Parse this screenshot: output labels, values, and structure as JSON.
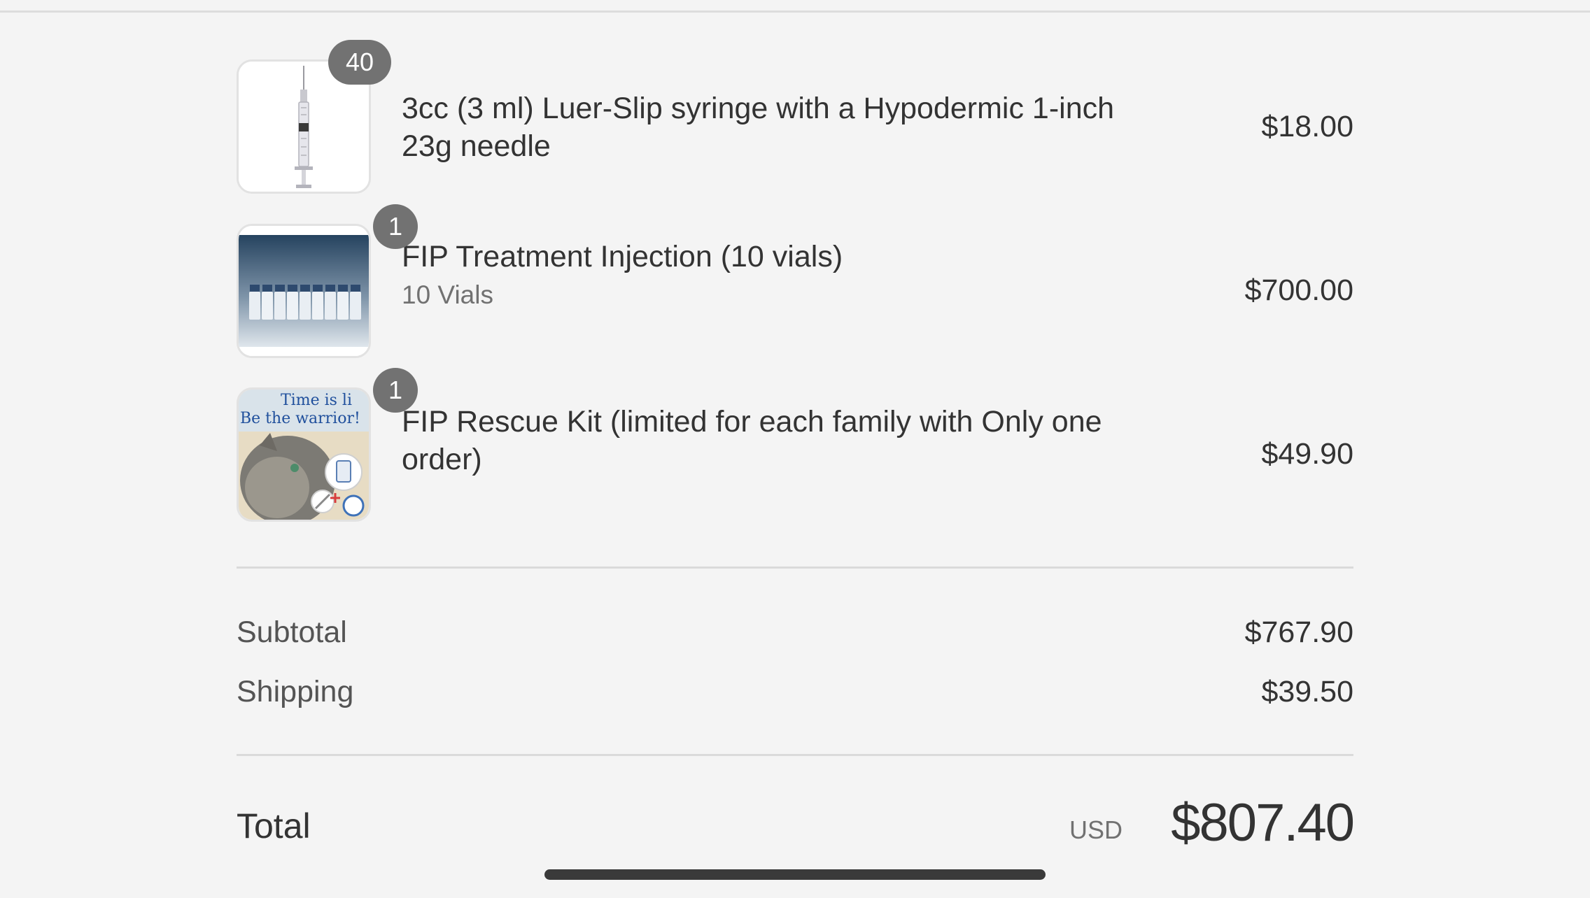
{
  "items": [
    {
      "quantity": "40",
      "title": "3cc (3 ml) Luer-Slip syringe with a Hypodermic 1-inch 23g needle",
      "variant": "",
      "price": "$18.00",
      "image": "syringe-image"
    },
    {
      "quantity": "1",
      "title": "FIP Treatment Injection (10 vials)",
      "variant": "10 Vials",
      "price": "$700.00",
      "image": "vials-image"
    },
    {
      "quantity": "1",
      "title": "FIP Rescue Kit (limited for each family with Only one order)",
      "variant": "",
      "price": "$49.90",
      "image": "rescue-kit-image",
      "image_text": [
        "Time is li",
        "Be the warrior!"
      ]
    }
  ],
  "summary": {
    "subtotal_label": "Subtotal",
    "subtotal_value": "$767.90",
    "shipping_label": "Shipping",
    "shipping_value": "$39.50"
  },
  "total": {
    "label": "Total",
    "currency": "USD",
    "amount": "$807.40"
  },
  "colors": {
    "background": "#f4f4f4",
    "badge": "#727272",
    "text": "#333333",
    "muted_text": "#717171",
    "divider": "#dadada"
  }
}
